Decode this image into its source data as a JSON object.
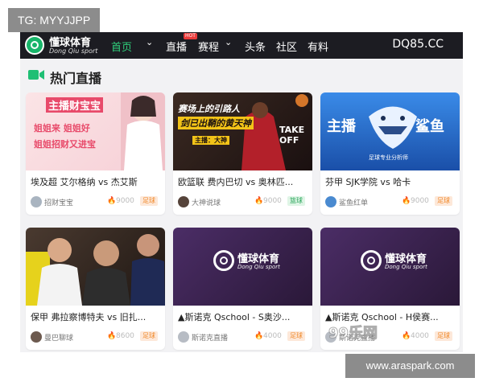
{
  "watermarks": {
    "top_left": "TG: MYYJJPP",
    "bottom_right": "www.araspark.com",
    "faint_overlay": "99乐网"
  },
  "header": {
    "logo_name": "懂球体育",
    "logo_sub": "Dong Qiu sport",
    "nav": [
      {
        "label": "首页"
      },
      {
        "label": "直播",
        "badge": "HOT"
      },
      {
        "label": "赛程"
      },
      {
        "label": "头条"
      },
      {
        "label": "社区"
      },
      {
        "label": "有料"
      }
    ],
    "domain": "DQ85.CC"
  },
  "section": {
    "title": "热门直播",
    "icon": "live-camera-icon"
  },
  "cards": [
    {
      "title": "埃及超 艾尔格纳 vs 杰艾斯",
      "anchor": "招财宝宝",
      "views": "9000",
      "tag": "足球",
      "thumb_texts": [
        "主播财宝宝",
        "姐姐来 姐姐好",
        "姐姐招财又进宝"
      ],
      "colors": {
        "bg": "#f7d8dd",
        "accent": "#e84a6a"
      }
    },
    {
      "title": "欧篮联 费内巴切 vs 奥林匹...",
      "anchor": "大神说球",
      "views": "9000",
      "tag": "篮球",
      "thumb_texts": [
        "赛场上的引路人",
        "剑已出鞘的黄天神",
        "TAKE OFF",
        "主播：大神"
      ],
      "colors": {
        "bg": "#2a1c1c",
        "accent": "#f2c318"
      }
    },
    {
      "title": "芬甲 SJK学院 vs 哈卡",
      "anchor": "鲨鱼红单",
      "views": "9000",
      "tag": "足球",
      "thumb_texts": [
        "主播",
        "鲨鱼",
        "足球专业分析师"
      ],
      "colors": {
        "bg": "#1f6fd1",
        "accent": "#ffffff"
      }
    },
    {
      "title": "保甲 弗拉察博特夫 vs 旧扎...",
      "anchor": "曼巴聊球",
      "views": "8600",
      "tag": "足球",
      "thumb_texts": [],
      "colors": {
        "bg": "#3a2a22",
        "accent": "#c9a27a"
      }
    },
    {
      "title": "▲斯诺克 Qschool - S奥沙...",
      "anchor": "斯诺克直播",
      "views": "4000",
      "tag": "足球",
      "thumb_texts": [
        "懂球体育",
        "Dong Qiu sport"
      ],
      "colors": {
        "bg": "#3a2352",
        "accent": "#ffffff"
      }
    },
    {
      "title": "▲斯诺克 Qschool - H侯赛...",
      "anchor": "斯诺克直播",
      "views": "4000",
      "tag": "足球",
      "thumb_texts": [
        "懂球体育",
        "Dong Qiu sport"
      ],
      "colors": {
        "bg": "#3a2352",
        "accent": "#ffffff"
      }
    }
  ]
}
